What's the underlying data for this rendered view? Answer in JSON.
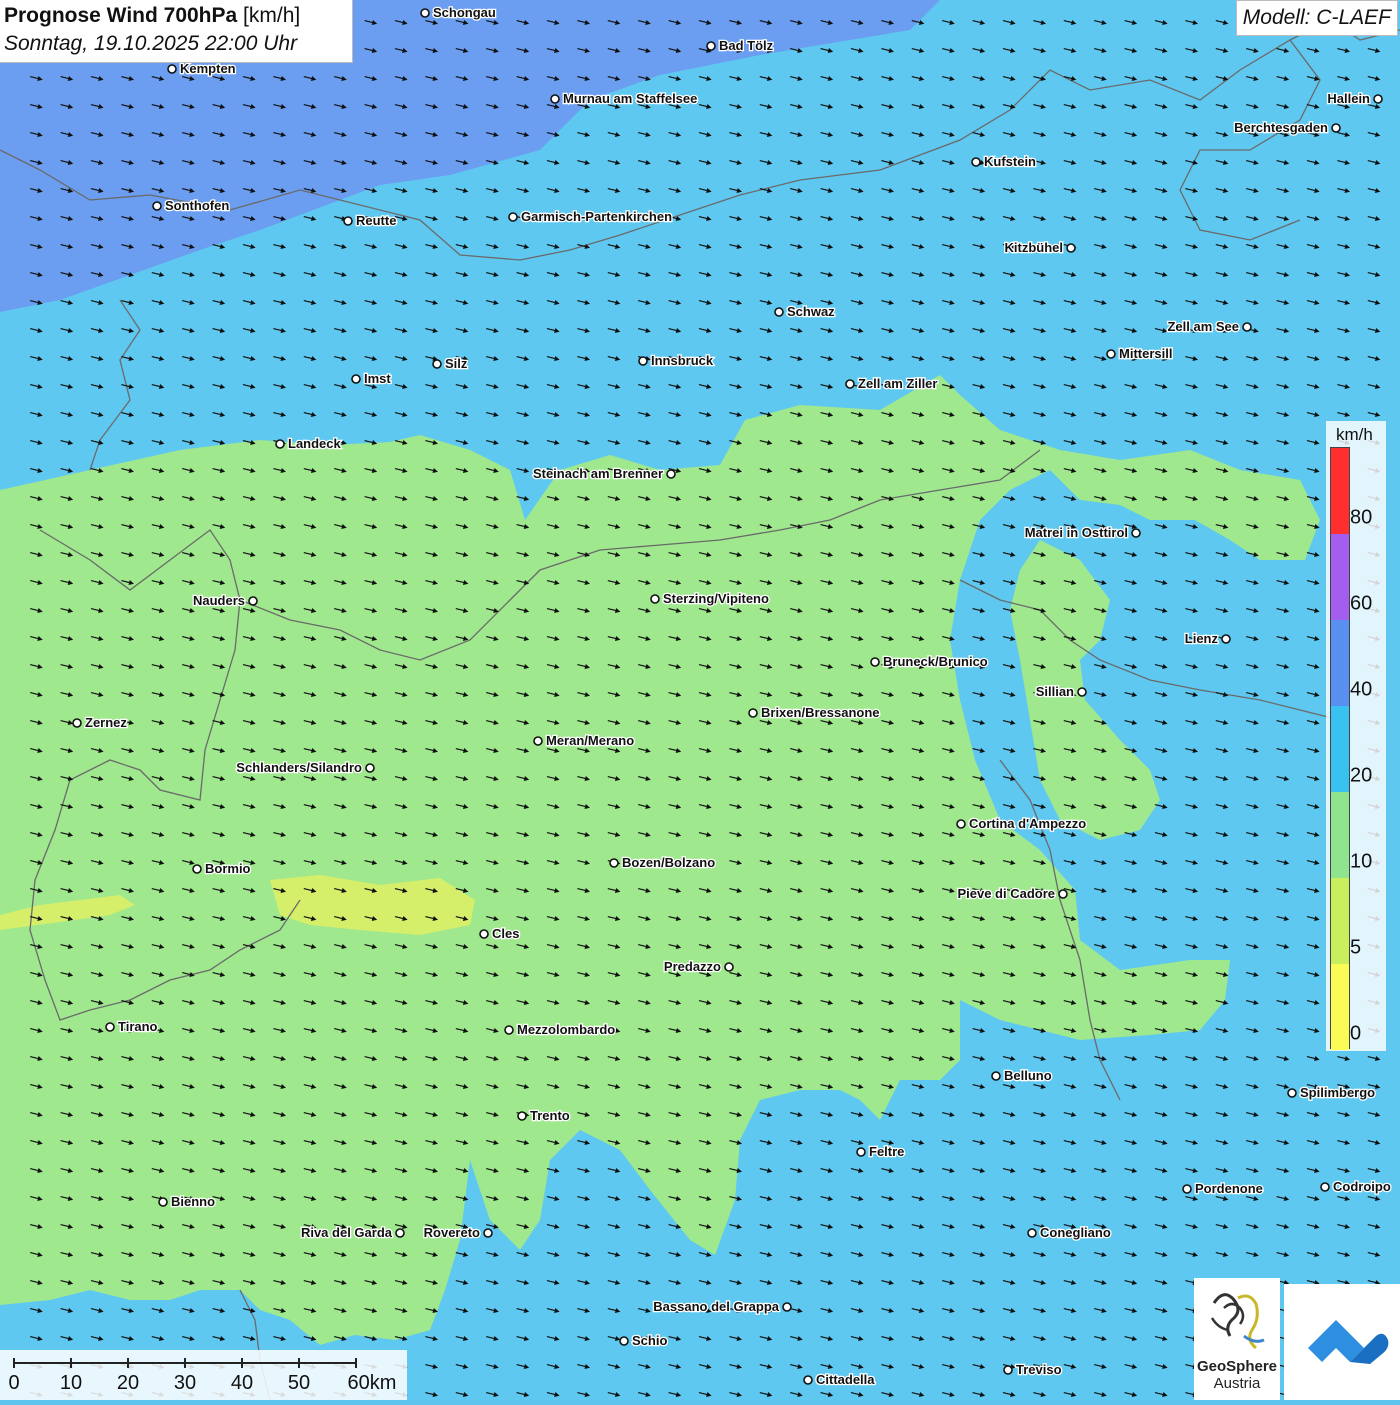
{
  "title": {
    "main": "Prognose Wind 700hPa",
    "unit": "[km/h]",
    "datetime": "Sonntag, 19.10.2025 22:00 Uhr"
  },
  "model": "Modell: C-LAEF",
  "legend": {
    "unit": "km/h",
    "ticks": [
      "80",
      "60",
      "40",
      "20",
      "10",
      "5",
      "0"
    ],
    "colors": [
      "#ff2f2f",
      "#a35ef0",
      "#5a8ff2",
      "#38c2ef",
      "#8ee58d",
      "#c9f05c",
      "#fbfb55"
    ]
  },
  "scale_bar": {
    "labels": [
      "0",
      "10",
      "20",
      "30",
      "40",
      "50",
      "60km"
    ]
  },
  "colors": {
    "zone_0_5": "#d6ef6a",
    "zone_5_10": "#9fe88d",
    "zone_10_20": "#5fc8f0",
    "zone_20_40": "#6b9ef0",
    "border": "#6a6a6a",
    "arrow": "#111111"
  },
  "wind_direction": "east-southeast",
  "cities": [
    {
      "name": "Schongau"
    },
    {
      "name": "Bad Tölz"
    },
    {
      "name": "Kempten"
    },
    {
      "name": "Murnau am Staffelsee"
    },
    {
      "name": "Hallein"
    },
    {
      "name": "Berchtesgaden"
    },
    {
      "name": "Kufstein"
    },
    {
      "name": "Sonthofen"
    },
    {
      "name": "Reutte"
    },
    {
      "name": "Garmisch-Partenkirchen"
    },
    {
      "name": "Kitzbühel"
    },
    {
      "name": "Schwaz"
    },
    {
      "name": "Zell am See"
    },
    {
      "name": "Mittersill"
    },
    {
      "name": "Innsbruck"
    },
    {
      "name": "Imst"
    },
    {
      "name": "Silz"
    },
    {
      "name": "Zell am Ziller"
    },
    {
      "name": "Landeck"
    },
    {
      "name": "Steinach am Brenner"
    },
    {
      "name": "Matrei in Osttirol"
    },
    {
      "name": "Nauders"
    },
    {
      "name": "Sterzing/Vipiteno"
    },
    {
      "name": "Lienz"
    },
    {
      "name": "Bruneck/Brunico"
    },
    {
      "name": "Sillian"
    },
    {
      "name": "Zernez"
    },
    {
      "name": "Brixen/Bressanone"
    },
    {
      "name": "Meran/Merano"
    },
    {
      "name": "Schlanders/Silandro"
    },
    {
      "name": "Cortina d'Ampezzo"
    },
    {
      "name": "Bormio"
    },
    {
      "name": "Bozen/Bolzano"
    },
    {
      "name": "Pieve di Cadore"
    },
    {
      "name": "Cles"
    },
    {
      "name": "Predazzo"
    },
    {
      "name": "Tirano"
    },
    {
      "name": "Mezzolombardo"
    },
    {
      "name": "Belluno"
    },
    {
      "name": "Spilimbergo"
    },
    {
      "name": "Trento"
    },
    {
      "name": "Feltre"
    },
    {
      "name": "Pordenone"
    },
    {
      "name": "Codroipo"
    },
    {
      "name": "Bienno"
    },
    {
      "name": "Riva del Garda"
    },
    {
      "name": "Rovereto"
    },
    {
      "name": "Conegliano"
    },
    {
      "name": "Bassano del Grappa"
    },
    {
      "name": "Schio"
    },
    {
      "name": "Treviso"
    },
    {
      "name": "Cittadella"
    }
  ],
  "logos": {
    "geosphere_line1": "GeoSphere",
    "geosphere_line2": "Austria"
  }
}
